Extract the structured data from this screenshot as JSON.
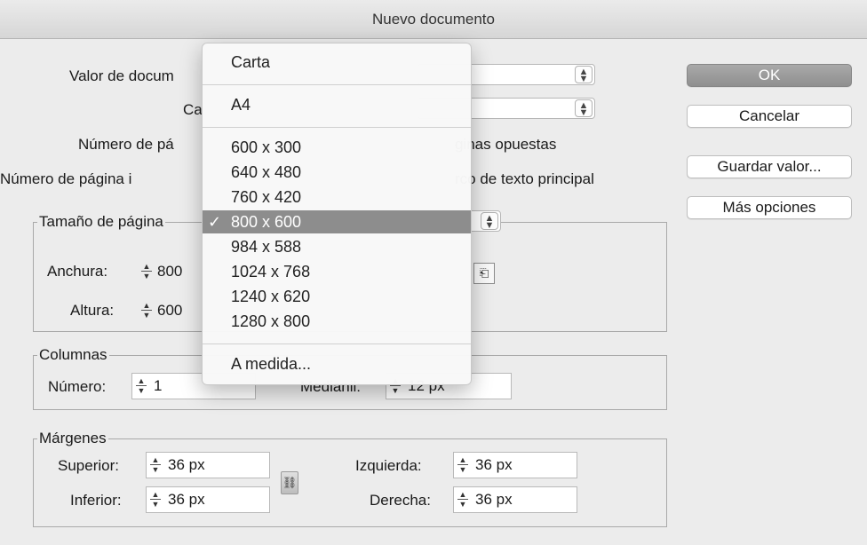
{
  "window": {
    "title": "Nuevo documento"
  },
  "labels": {
    "valor_documento": "Valor de docum",
    "ca": "Ca",
    "numero_paginas": "Número de pá",
    "paginas_opuestas": "ginas opuestas",
    "numero_pagina_inicial": "Número de página i",
    "marco_texto": "rco de texto principal"
  },
  "buttons": {
    "ok": "OK",
    "cancel": "Cancelar",
    "save_preset": "Guardar valor...",
    "more_options": "Más opciones"
  },
  "page_size": {
    "legend": "Tamaño de página",
    "width_label": "Anchura:",
    "width_value": "800",
    "height_label": "Altura:",
    "height_value": "600"
  },
  "columns": {
    "legend": "Columnas",
    "number_label": "Número:",
    "number_value": "1",
    "gutter_label": "Medianil:",
    "gutter_value": "12 px"
  },
  "margins": {
    "legend": "Márgenes",
    "top_label": "Superior:",
    "top_value": "36 px",
    "bottom_label": "Inferior:",
    "bottom_value": "36 px",
    "left_label": "Izquierda:",
    "left_value": "36 px",
    "right_label": "Derecha:",
    "right_value": "36 px"
  },
  "menu": {
    "items": [
      "Carta",
      "A4",
      "600 x 300",
      "640 x 480",
      "760 x 420",
      "800 x 600",
      "984 x 588",
      "1024 x 768",
      "1240 x 620",
      "1280 x 800",
      "A medida..."
    ],
    "selected": "800 x 600",
    "check": "✓"
  },
  "colors": {
    "window_bg": "#ececec",
    "menu_highlight": "#8d8d8d",
    "default_button": "#999999"
  },
  "icons": {
    "stepper": "up-down-stepper-icon",
    "select_arrows": "up-down-chevron-icon",
    "chain": "chain-link-icon",
    "orientation": "orientation-icon"
  }
}
